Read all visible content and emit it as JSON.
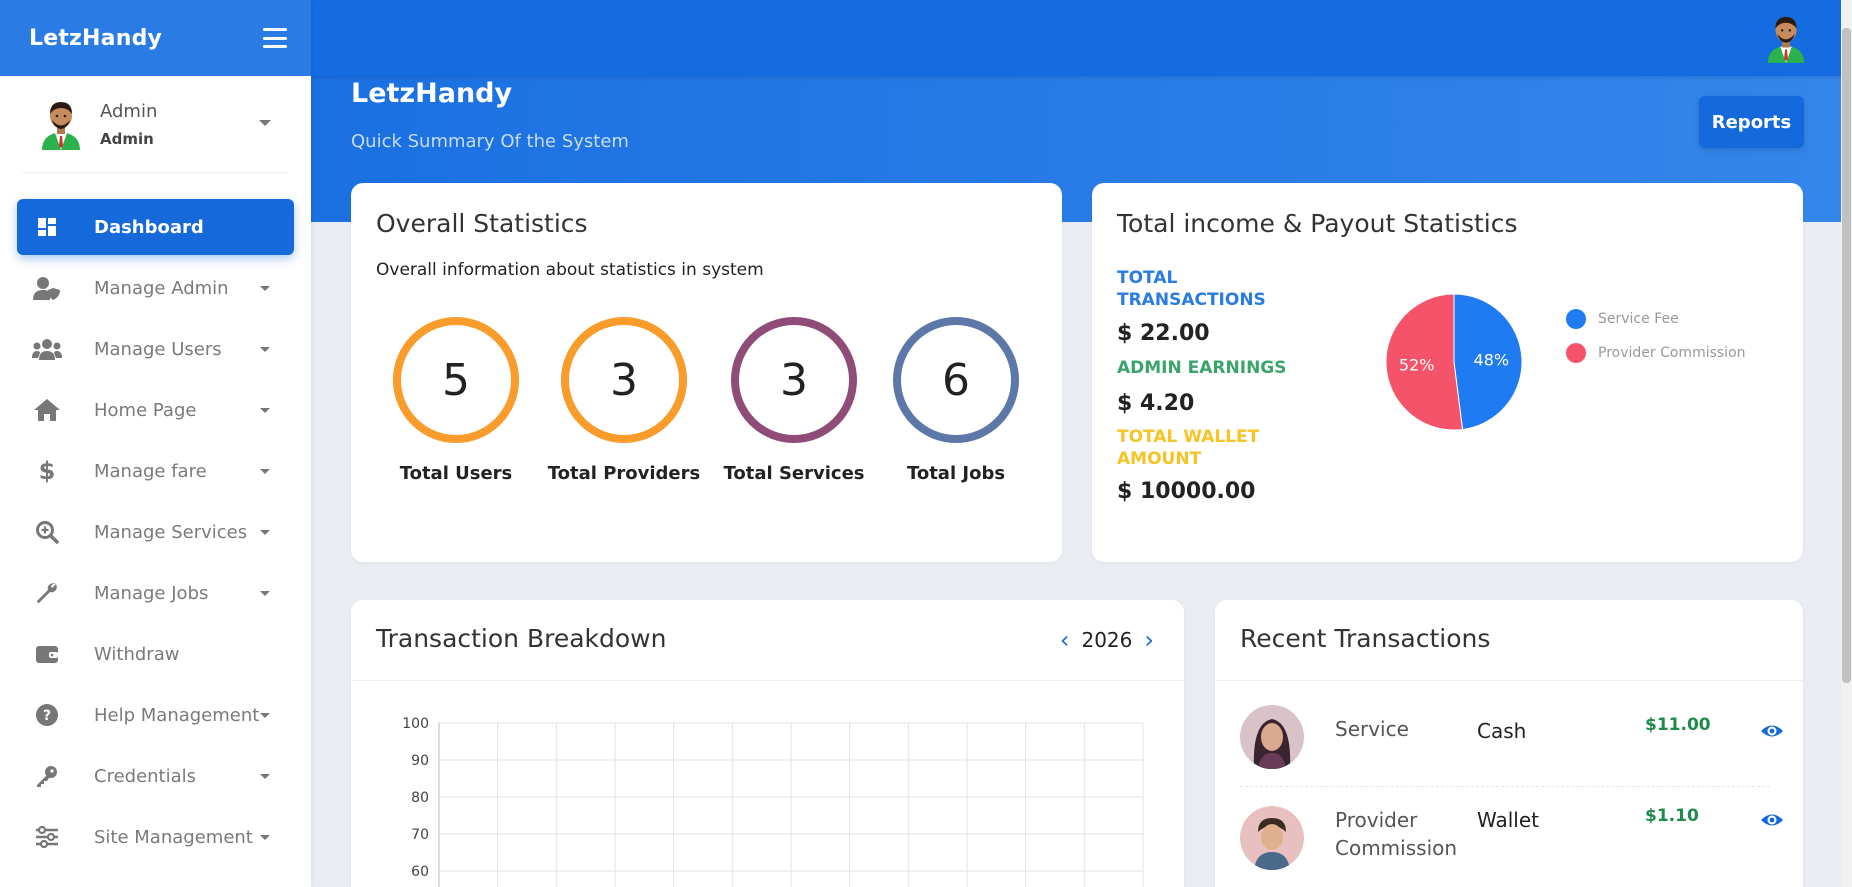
{
  "brand": {
    "name": "LetzHandy"
  },
  "user": {
    "name": "Admin",
    "role": "Admin"
  },
  "menu": [
    {
      "label": "Dashboard",
      "icon": "dashboard-icon",
      "active": true
    },
    {
      "label": "Manage Admin",
      "icon": "user-shield-icon"
    },
    {
      "label": "Manage Users",
      "icon": "users-icon"
    },
    {
      "label": "Home Page",
      "icon": "home-icon"
    },
    {
      "label": "Manage fare",
      "icon": "dollar-icon"
    },
    {
      "label": "Manage Services",
      "icon": "search-plus-icon"
    },
    {
      "label": "Manage Jobs",
      "icon": "wrench-icon"
    },
    {
      "label": "Withdraw",
      "icon": "wallet-icon"
    },
    {
      "label": "Help Management",
      "icon": "help-icon"
    },
    {
      "label": "Credentials",
      "icon": "key-icon"
    },
    {
      "label": "Site Management",
      "icon": "sliders-icon"
    }
  ],
  "hero": {
    "title": "LetzHandy",
    "subtitle": "Quick Summary Of the System",
    "reports_label": "Reports"
  },
  "overall": {
    "title": "Overall Statistics",
    "subtitle": "Overall information about statistics in system",
    "stats": [
      {
        "value": "5",
        "label": "Total Users",
        "color": "#f99c2c"
      },
      {
        "value": "3",
        "label": "Total Providers",
        "color": "#f99c2c"
      },
      {
        "value": "3",
        "label": "Total Services",
        "color": "#8e4c77"
      },
      {
        "value": "6",
        "label": "Total Jobs",
        "color": "#5c77a8"
      }
    ]
  },
  "income": {
    "title": "Total income & Payout Statistics",
    "total_transactions_label": "TOTAL TRANSACTIONS",
    "total_transactions_value": "$ 22.00",
    "admin_earnings_label": "ADMIN EARNINGS",
    "admin_earnings_value": "$ 4.20",
    "wallet_label": "TOTAL WALLET AMOUNT",
    "wallet_value": "$ 10000.00",
    "colors": {
      "transactions": "#2a7be4",
      "earnings": "#3aa46b",
      "wallet": "#f7c325"
    }
  },
  "chart_data": {
    "type": "pie",
    "labels": [
      "Service Fee",
      "Provider Commission"
    ],
    "values": [
      48,
      52
    ],
    "value_labels": [
      "48%",
      "52%"
    ],
    "colors": [
      "#1f7bf2",
      "#f5536a"
    ],
    "legend": "right"
  },
  "breakdown": {
    "title": "Transaction Breakdown",
    "year": "2026",
    "y_ticks": [
      "100",
      "90",
      "80",
      "70",
      "60"
    ],
    "ylim": [
      0,
      100
    ]
  },
  "recent": {
    "title": "Recent Transactions",
    "rows": [
      {
        "type": "Service",
        "method": "Cash",
        "amount": "$11.00"
      },
      {
        "type": "Provider Commission",
        "method": "Wallet",
        "amount": "$1.10"
      }
    ]
  }
}
